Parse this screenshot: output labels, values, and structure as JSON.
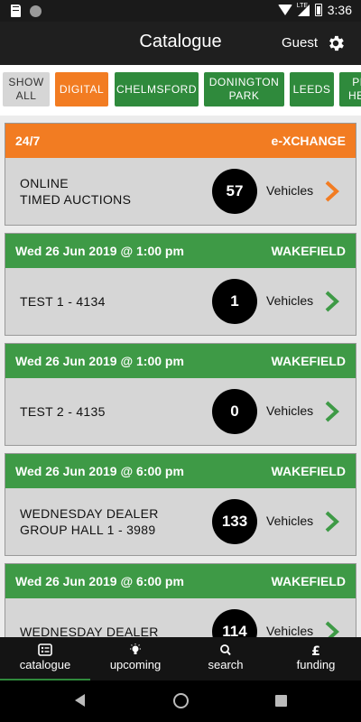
{
  "status_bar": {
    "time": "3:36",
    "network": "LTE"
  },
  "app_bar": {
    "title": "Catalogue",
    "user": "Guest"
  },
  "filters": [
    {
      "label": "SHOW\nALL",
      "style": "grey"
    },
    {
      "label": "DIGITAL",
      "style": "orange"
    },
    {
      "label": "CHELMSFORD",
      "style": "green"
    },
    {
      "label": "DONINGTON\nPARK",
      "style": "green"
    },
    {
      "label": "LEEDS",
      "style": "green"
    },
    {
      "label": "PR\nHEA",
      "style": "green"
    }
  ],
  "sales": [
    {
      "date": "24/7",
      "location": "e-XCHANGE",
      "name": "ONLINE\nTIMED AUCTIONS",
      "count": "57",
      "unit": "Vehicles",
      "color": "orange"
    },
    {
      "date": "Wed 26 Jun 2019 @ 1:00 pm",
      "location": "WAKEFIELD",
      "name": "TEST 1 - 4134",
      "count": "1",
      "unit": "Vehicles",
      "color": "green"
    },
    {
      "date": "Wed 26 Jun 2019 @ 1:00 pm",
      "location": "WAKEFIELD",
      "name": "TEST 2 - 4135",
      "count": "0",
      "unit": "Vehicles",
      "color": "green"
    },
    {
      "date": "Wed 26 Jun 2019 @ 6:00 pm",
      "location": "WAKEFIELD",
      "name": "WEDNESDAY DEALER\nGROUP HALL 1 - 3989",
      "count": "133",
      "unit": "Vehicles",
      "color": "green"
    },
    {
      "date": "Wed 26 Jun 2019 @ 6:00 pm",
      "location": "WAKEFIELD",
      "name": "WEDNESDAY DEALER",
      "count": "114",
      "unit": "Vehicles",
      "color": "green"
    }
  ],
  "bottom_nav": [
    {
      "label": "catalogue",
      "icon": "catalogue-icon",
      "active": true
    },
    {
      "label": "upcoming",
      "icon": "lightbulb-icon",
      "active": false
    },
    {
      "label": "search",
      "icon": "search-icon",
      "active": false
    },
    {
      "label": "funding",
      "icon": "pound-icon",
      "active": false
    }
  ],
  "colors": {
    "orange": "#f27c22",
    "green": "#3e9a46",
    "dark": "#1f1f1f"
  }
}
